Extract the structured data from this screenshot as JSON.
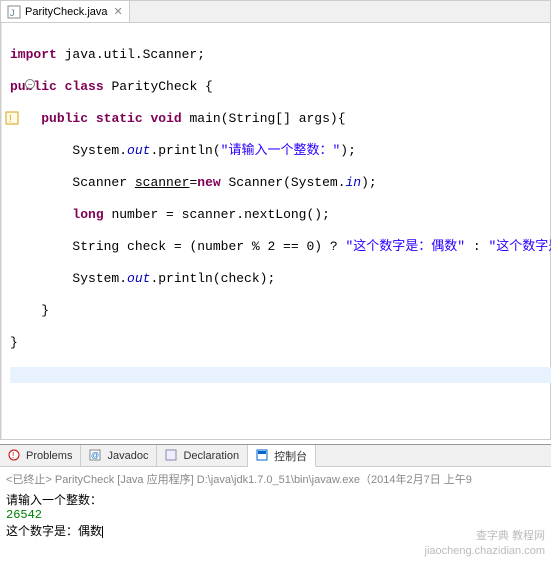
{
  "editor": {
    "tab": {
      "filename": "ParityCheck.java"
    },
    "code": {
      "l1": {
        "kw1": "import",
        "t1": " java.util.Scanner;"
      },
      "l2": {
        "kw1": "public",
        "kw2": "class",
        "t1": " ParityCheck {"
      },
      "l3": {
        "kw1": "public",
        "kw2": "static",
        "kw3": "void",
        "t1": " main(String[] args){"
      },
      "l4": {
        "t1": "System.",
        "f1": "out",
        "t2": ".println(",
        "s1": "\"请输入一个整数：\"",
        "t3": ");"
      },
      "l5": {
        "t1": "Scanner ",
        "u1": "scanner",
        "t2": "=",
        "kw1": "new",
        "t3": " Scanner(System.",
        "f1": "in",
        "t4": ");"
      },
      "l6": {
        "kw1": "long",
        "t1": " number = scanner.nextLong();"
      },
      "l7": {
        "t1": "String check = (number % 2 == 0) ? ",
        "s1": "\"这个数字是：偶数\"",
        "t2": " : ",
        "s2": "\"这个数字是：奇数\"",
        "t3": ";"
      },
      "l8": {
        "t1": "System.",
        "f1": "out",
        "t2": ".println(check);"
      },
      "l9": "}",
      "l10": "}"
    }
  },
  "bottom": {
    "tabs": {
      "problems": "Problems",
      "javadoc": "Javadoc",
      "declaration": "Declaration",
      "console": "控制台"
    },
    "console": {
      "header": "<已终止> ParityCheck [Java 应用程序] D:\\java\\jdk1.7.0_51\\bin\\javaw.exe（2014年2月7日 上午9",
      "prompt": "请输入一个整数：",
      "input": "26542",
      "output": "这个数字是：偶数"
    }
  },
  "watermark1": "查字典 教程网",
  "watermark2": "jiaocheng.chazidian.com"
}
